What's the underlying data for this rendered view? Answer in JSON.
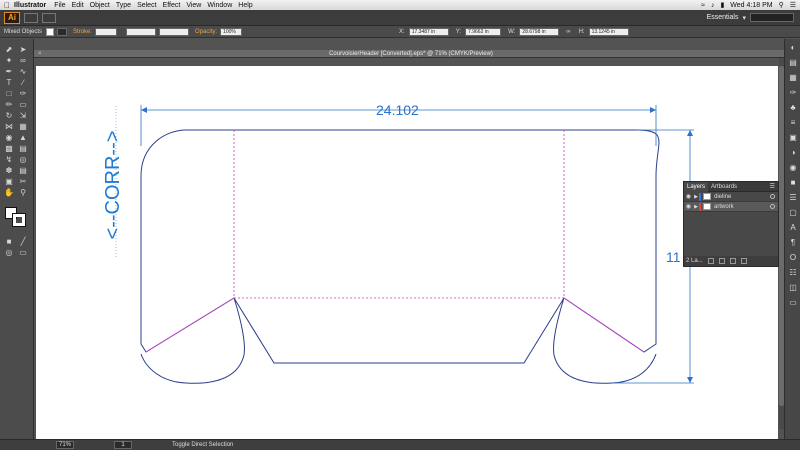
{
  "menubar": {
    "apple": "",
    "app_name": "Illustrator",
    "menus": [
      "File",
      "Edit",
      "Object",
      "Type",
      "Select",
      "Effect",
      "View",
      "Window",
      "Help"
    ],
    "clock": "Wed 4:18 PM"
  },
  "appbar": {
    "logo": "Ai",
    "workspace": "Essentials"
  },
  "controlbar": {
    "selection": "Mixed Objects",
    "stroke_label": "Stroke:",
    "opacity_label": "Opacity:",
    "opacity_value": "100%",
    "x_label": "X:",
    "x_value": "17.3487 in",
    "y_label": "Y:",
    "y_value": "7.9662 in",
    "w_label": "W:",
    "w_value": "28.6798 in",
    "h_label": "H:",
    "h_value": "13.1245 in"
  },
  "document": {
    "tab_title": "CourvoisierHeader [Converted].eps* @ 71% (CMYK/Preview)",
    "close": "×"
  },
  "artwork": {
    "dimension_width": "24.102",
    "dimension_height": "11",
    "corr_label": "<--CORR-->"
  },
  "layers_panel": {
    "tabs": [
      "Layers",
      "Artboards"
    ],
    "layers": [
      {
        "name": "dieline",
        "color": "#3f6fe0"
      },
      {
        "name": "artwork",
        "color": "#e04040"
      }
    ],
    "footer_count": "2 La..."
  },
  "statusbar": {
    "zoom": "71%",
    "page": "1",
    "status": "Toggle Direct Selection"
  },
  "icons": {
    "tools": [
      "selection-tool-icon",
      "direct-selection-tool-icon",
      "magic-wand-icon",
      "lasso-icon",
      "pen-tool-icon",
      "curvature-icon",
      "type-tool-icon",
      "line-tool-icon",
      "rectangle-tool-icon",
      "paintbrush-icon",
      "pencil-icon",
      "eraser-icon",
      "rotate-icon",
      "scale-icon",
      "width-tool-icon",
      "free-transform-icon",
      "shape-builder-icon",
      "perspective-icon",
      "mesh-icon",
      "gradient-icon",
      "eyedropper-icon",
      "blend-icon",
      "symbol-sprayer-icon",
      "graph-icon",
      "artboard-tool-icon",
      "slice-icon",
      "hand-tool-icon",
      "zoom-tool-icon"
    ],
    "dock": [
      "color-icon",
      "color-guide-icon",
      "swatches-icon",
      "brushes-icon",
      "symbols-icon",
      "stroke-icon",
      "gradient-panel-icon",
      "transparency-icon",
      "appearance-icon",
      "graphic-styles-icon",
      "layers-panel-icon",
      "artboards-panel-icon",
      "character-icon",
      "paragraph-icon",
      "opentype-icon",
      "align-icon",
      "transform-icon",
      "pathfinder-icon"
    ]
  },
  "colors": {
    "dieline": "#2b3f8c",
    "fold": "#c040c0",
    "dimension": "#2a73c6"
  }
}
